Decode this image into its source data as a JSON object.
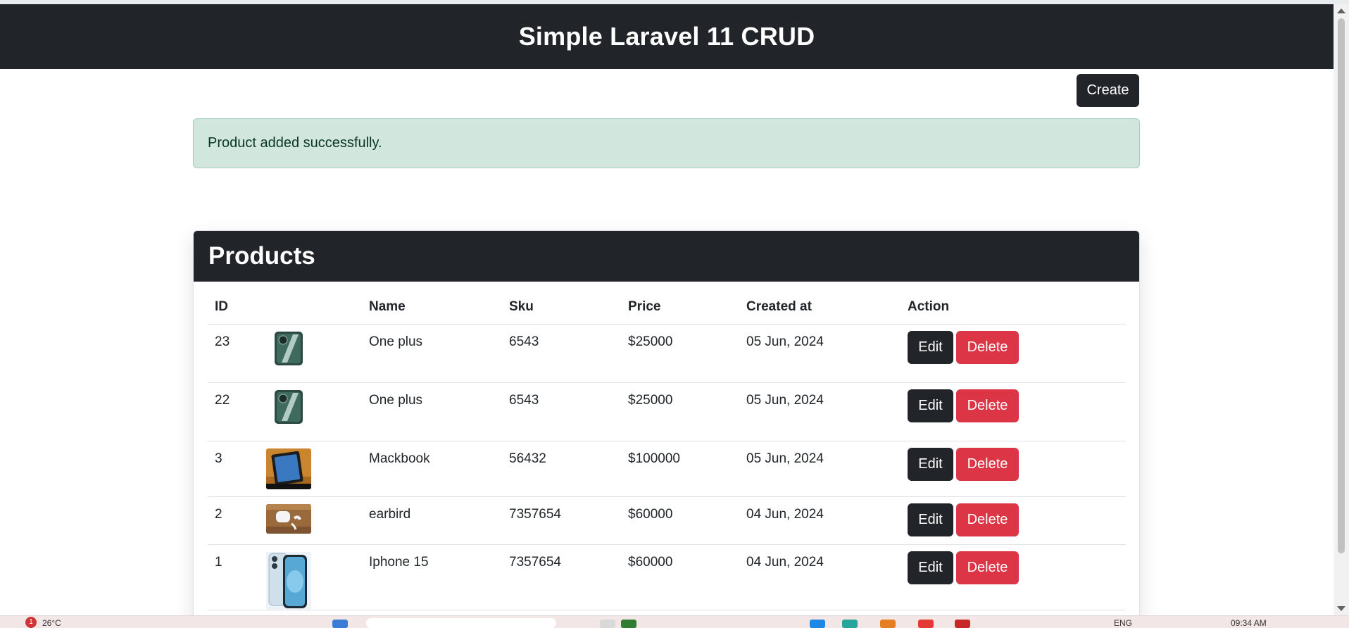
{
  "header": {
    "title": "Simple Laravel 11 CRUD"
  },
  "toolbar": {
    "create_label": "Create"
  },
  "alert": {
    "message": "Product added successfully."
  },
  "card": {
    "title": "Products"
  },
  "table": {
    "headers": {
      "id": "ID",
      "image": "",
      "name": "Name",
      "sku": "Sku",
      "price": "Price",
      "created": "Created at",
      "action": "Action"
    },
    "rows": [
      {
        "id": "23",
        "image_icon": "oneplus-phone-image",
        "name": "One plus",
        "sku": "6543",
        "price": "$25000",
        "created": "05 Jun, 2024",
        "edit": "Edit",
        "delete": "Delete"
      },
      {
        "id": "22",
        "image_icon": "oneplus-phone-image",
        "name": "One plus",
        "sku": "6543",
        "price": "$25000",
        "created": "05 Jun, 2024",
        "edit": "Edit",
        "delete": "Delete"
      },
      {
        "id": "3",
        "image_icon": "tablet-image",
        "name": "Mackbook",
        "sku": "56432",
        "price": "$100000",
        "created": "05 Jun, 2024",
        "edit": "Edit",
        "delete": "Delete"
      },
      {
        "id": "2",
        "image_icon": "earbuds-image",
        "name": "earbird",
        "sku": "7357654",
        "price": "$60000",
        "created": "04 Jun, 2024",
        "edit": "Edit",
        "delete": "Delete"
      },
      {
        "id": "1",
        "image_icon": "iphone-image",
        "name": "Iphone 15",
        "sku": "7357654",
        "price": "$60000",
        "created": "04 Jun, 2024",
        "edit": "Edit",
        "delete": "Delete"
      }
    ]
  },
  "taskbar": {
    "badge": "1",
    "temperature": "26°C",
    "language": "ENG",
    "time": "09:34 AM"
  },
  "colors": {
    "dark": "#212529",
    "danger": "#dc3545",
    "success_bg": "#d1e7dd",
    "success_text": "#0a3622"
  }
}
